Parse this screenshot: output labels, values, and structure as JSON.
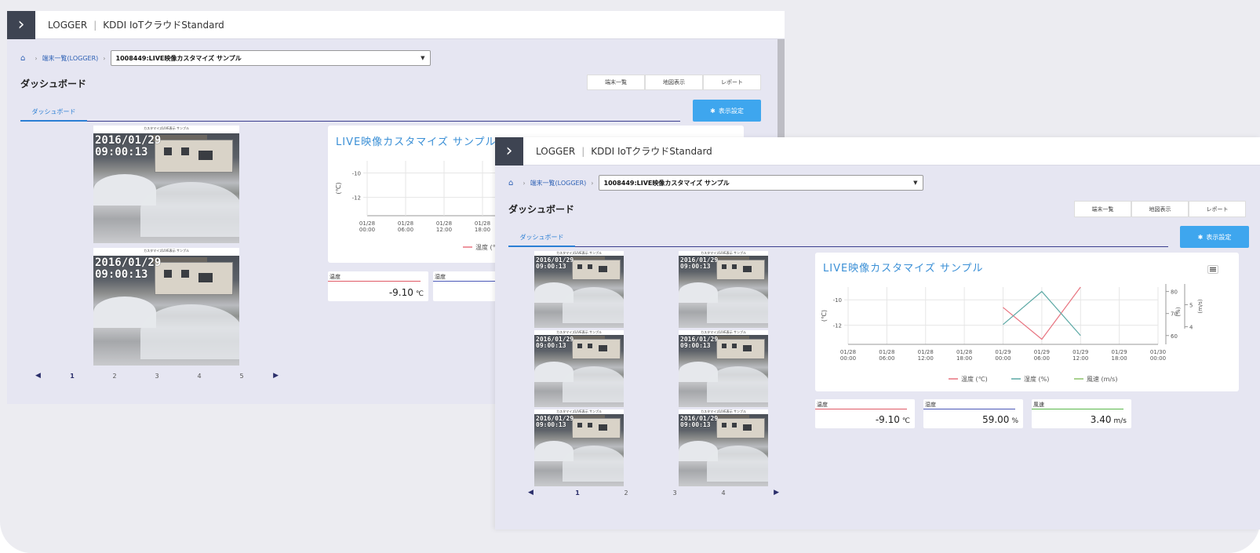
{
  "app": {
    "name": "LOGGER",
    "service": "KDDI IoTクラウドStandard"
  },
  "breadcrumb": {
    "list_label": "端末一覧(LOGGER)",
    "device_selected": "1008449:LIVE映像カスタマイズ サンプル"
  },
  "page": {
    "title": "ダッシュボード",
    "tab_label": "ダッシュボード"
  },
  "actions": {
    "device_list": "端末一覧",
    "map_view": "地図表示",
    "report": "レポート",
    "display_settings": "表示設定"
  },
  "thumbnail": {
    "caption": "カスタマイズLIVE表示 サンプル",
    "timestamp_date": "2016/01/29",
    "timestamp_time": "09:00:13"
  },
  "pagination": {
    "prev": "◀",
    "next": "▶",
    "back_pages": [
      "1",
      "2",
      "3",
      "4",
      "5"
    ],
    "front_pages": [
      "1",
      "2",
      "3",
      "4"
    ]
  },
  "chart_data": {
    "type": "line",
    "title": "LIVE映像カスタマイズ サンプル",
    "x_ticks": [
      [
        "01/28",
        "00:00"
      ],
      [
        "01/28",
        "06:00"
      ],
      [
        "01/28",
        "12:00"
      ],
      [
        "01/28",
        "18:00"
      ],
      [
        "01/29",
        "00:00"
      ],
      [
        "01/29",
        "06:00"
      ],
      [
        "01/29",
        "12:00"
      ],
      [
        "01/29",
        "18:00"
      ],
      [
        "01/30",
        "00:00"
      ]
    ],
    "y_left": {
      "label": "(℃)",
      "ticks": [
        -10,
        -12
      ],
      "range": [
        -13.5,
        -9
      ]
    },
    "y_right1": {
      "label": "(%)",
      "ticks": [
        80,
        70,
        60
      ],
      "range": [
        56,
        82
      ]
    },
    "y_right2": {
      "label": "(m/s)",
      "ticks": [
        5,
        4
      ],
      "range": [
        3.2,
        5.8
      ]
    },
    "series": [
      {
        "name": "温度 (℃)",
        "color": "#e8737f",
        "axis": "left",
        "x_hours": [
          24,
          30,
          36
        ],
        "values": [
          -10.6,
          -13.1,
          -9.0
        ]
      },
      {
        "name": "湿度 (%)",
        "color": "#5aa8a4",
        "axis": "right1",
        "x_hours": [
          24,
          30,
          36
        ],
        "values": [
          65,
          80,
          60
        ]
      },
      {
        "name": "風速 (m/s)",
        "color": "#8cc26a",
        "axis": "right2",
        "x_hours": [],
        "values": []
      }
    ],
    "back_x_ticks": [
      [
        "01/28",
        "00:00"
      ],
      [
        "01/28",
        "06:00"
      ],
      [
        "01/28",
        "12:00"
      ],
      [
        "01/28",
        "18:00"
      ]
    ],
    "back_legend": "温度 (℃"
  },
  "readings": [
    {
      "label": "温度",
      "value": "-9.10",
      "unit": "℃",
      "color": "#e05a66"
    },
    {
      "label": "湿度",
      "value": "59.00",
      "unit": "%",
      "color": "#4a58b8"
    },
    {
      "label": "風速",
      "value": "3.40",
      "unit": "m/s",
      "color": "#5ab84a"
    }
  ],
  "back_readings": [
    {
      "label": "温度",
      "value": "-9.10",
      "unit": "℃"
    },
    {
      "label": "湿度"
    }
  ]
}
